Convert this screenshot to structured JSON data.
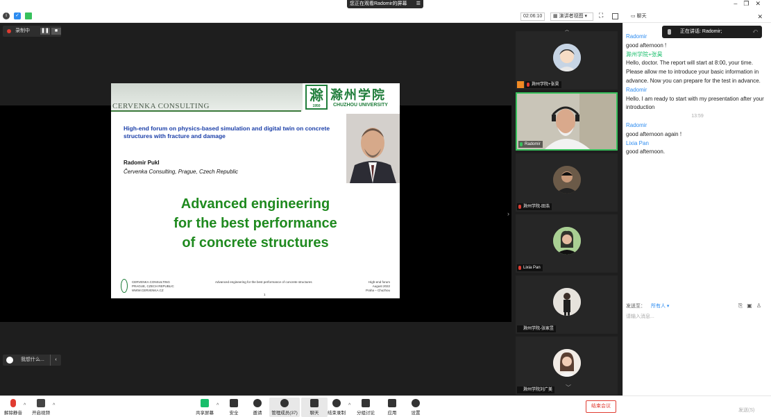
{
  "window": {
    "share_banner": "您正在观看Radomir的屏幕",
    "timer": "02:06:10",
    "view_mode": "演讲者视图",
    "chat_panel_title": "聊天"
  },
  "recording": {
    "label": "录制中"
  },
  "slide": {
    "brand": "CERVENKA CONSULTING",
    "university_cn": "滁州学院",
    "university_en": "CHUZHOU UNIVERSITY",
    "seal_year": "1950",
    "forum_title": "High-end forum on physics-based simulation and digital twin on concrete structures with fracture and damage",
    "author": "Radomir Pukl",
    "affiliation": "Červenka Consulting, Prague, Czech Republic",
    "headline_1": "Advanced engineering",
    "headline_2": "for the best performance",
    "headline_3": "of concrete structures",
    "footer_left_1": "CERVENKA CONSULTING",
    "footer_left_2": "PRAGUE, CZECH REPUBLIC",
    "footer_left_3": "WWW.CERVENKA.CZ",
    "footer_center": "Advanced engineering for the best performance of concrete structures",
    "page_number": "1",
    "footer_right_1": "High-end forum",
    "footer_right_2": "August 2022",
    "footer_right_3": "Praha – Chuzhou"
  },
  "pause_bar": {
    "label": "我想什么..."
  },
  "participants": [
    {
      "name": "滁州学院+张昊",
      "active": false
    },
    {
      "name": "Radomir",
      "active": true
    },
    {
      "name": "滁州学院-田浩",
      "active": false
    },
    {
      "name": "Lixia Pan",
      "active": false
    },
    {
      "name": "滁州学院-张家昱",
      "active": false
    },
    {
      "name": "滁州学院刘广美",
      "active": false
    }
  ],
  "chat": {
    "speaking": "正在讲话: Radomir;",
    "messages": [
      {
        "sender": "Radomir",
        "text": "good afternoon !"
      },
      {
        "sender": "滁州学院+张昊",
        "text": "Hello, doctor. The report will start at 8:00, your time. Please allow me to introduce your basic information in advance. Now you can prepare for the test in advance."
      },
      {
        "sender": "Radomir",
        "text": "Hello. I am ready to start with my presentation after your introduction"
      },
      {
        "sender": "Radomir",
        "text": "good afternoon again !"
      },
      {
        "sender": "Lixia Pan",
        "text": "good afternoon."
      }
    ],
    "timestamp": "13:59",
    "send_to_label": "发送至：",
    "send_to_value": "所有人",
    "input_placeholder": "请输入消息...",
    "send_button": "发送(S)"
  },
  "toolbar": {
    "unmute": "解除静音",
    "start_video": "开启视频",
    "share_screen": "共享屏幕",
    "security": "安全",
    "invite": "邀请",
    "participants": "管理成员(37)",
    "chat": "聊天",
    "end_recording": "结束录制",
    "breakout": "分组讨论",
    "apps": "应用",
    "settings": "设置",
    "end_meeting": "结束会议"
  },
  "colors": {
    "accent_blue": "#2d8cf0",
    "accent_green": "#19be6b",
    "end_red": "#e03c31",
    "slide_green": "#1f8a1f",
    "active_tile": "#37c15c"
  }
}
